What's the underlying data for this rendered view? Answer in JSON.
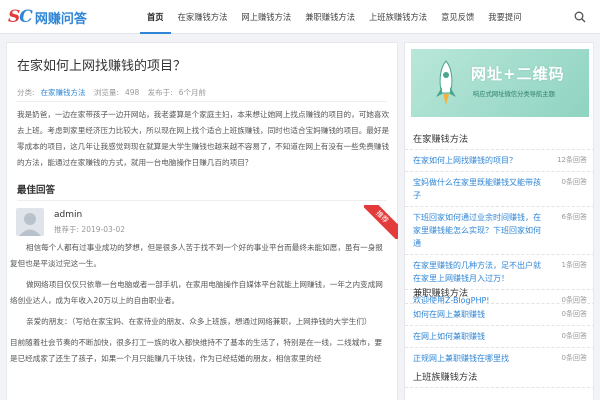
{
  "logo": {
    "mark": "SC",
    "text": "网赚问答"
  },
  "nav": [
    {
      "label": "首页",
      "active": true
    },
    {
      "label": "在家赚钱方法",
      "active": false
    },
    {
      "label": "网上赚钱方法",
      "active": false
    },
    {
      "label": "兼职赚钱方法",
      "active": false
    },
    {
      "label": "上班族赚钱方法",
      "active": false
    },
    {
      "label": "意见反馈",
      "active": false
    },
    {
      "label": "我要提问",
      "active": false
    }
  ],
  "question": {
    "title": "在家如何上网找赚钱的项目？",
    "category_label": "分类:",
    "category": "在家赚钱方法",
    "views_label": "浏览量:",
    "views": "498",
    "posted_label": "发布于:",
    "posted": "6个月前",
    "body": "我是奶爸，一边在家带孩子一边开网站，我老婆算是个家庭主妇，本来想让她网上找点赚钱的项目的，可她喜欢去上班。考虑到家里经济压力比较大，所以现在网上找个适合上班族赚钱，同时也适合宝妈赚钱的项目。最好是零成本的项目，这几年让我感觉到现在就算是大学生赚钱也越来越不容易了，不知道在网上有没有一些免费赚钱的方法，能通过在家赚钱的方式，就用一台电脑操作日赚几百的项目？"
  },
  "best_answer": {
    "heading": "最佳回答",
    "user": "admin",
    "date_label": "推荐于:",
    "date": "2019-03-02",
    "badge": "推荐",
    "paragraphs": [
      "相信每个人都有过事业成功的梦想，但是很多人苦于找不到一个好的事业平台而最终未能如愿，虽有一身报复但也是平淡过完这一生。",
      "做网络项目仅仅只依靠一台电脑或者一部手机，在家用电脑操作自媒体平台就能上网赚钱，一年之内变成网络创业达人，成为年收入20万以上的自由职业者。",
      "亲爱的朋友：（写给在家宝妈、在家待业的朋友、众多上班族，想通过网络兼职，上网挣钱的大学生们）",
      "目前随着社会节奏的不断加快，很多打工一族的收入都快维持不了基本的生活了，特别是在一线，二线城市，要是已经成家了还生了孩子，如果一个月只能赚几千块钱，作为已经结婚的朋友，相信家里的经"
    ]
  },
  "sidebar": {
    "banner": {
      "title": "网址+二维码",
      "subtitle": "响应式网址微信分类导航主题"
    },
    "sections": [
      {
        "heading": "在家赚钱方法",
        "items": [
          {
            "label": "在家如何上网找赚钱的项目？",
            "count": "12条回答"
          },
          {
            "label": "宝妈做什么在家里既能赚钱又能带孩子",
            "count": "0条回答"
          },
          {
            "label": "下班回家如何通过业余时间赚钱，在家里赚钱能怎么实现？下班回家如何通",
            "count": "6条回答"
          },
          {
            "label": "在家里赚钱的几种方法，足不出户就在家里上网赚钱月入过万！",
            "count": "1条回答"
          },
          {
            "label": "欢迎使用Z-BlogPHP!",
            "count": "0条回答"
          }
        ]
      },
      {
        "heading": "兼职赚钱方法",
        "items": [
          {
            "label": "如何在网上兼职赚钱",
            "count": "0条回答"
          },
          {
            "label": "在网上如何兼职赚钱",
            "count": "0条回答"
          },
          {
            "label": "正规网上兼职赚钱在哪里找",
            "count": "0条回答"
          }
        ]
      },
      {
        "heading": "上班族赚钱方法",
        "items": []
      }
    ]
  },
  "colors": {
    "accent": "#2f86d6",
    "badge": "#e33b3b",
    "banner": "#a8dfcf"
  }
}
